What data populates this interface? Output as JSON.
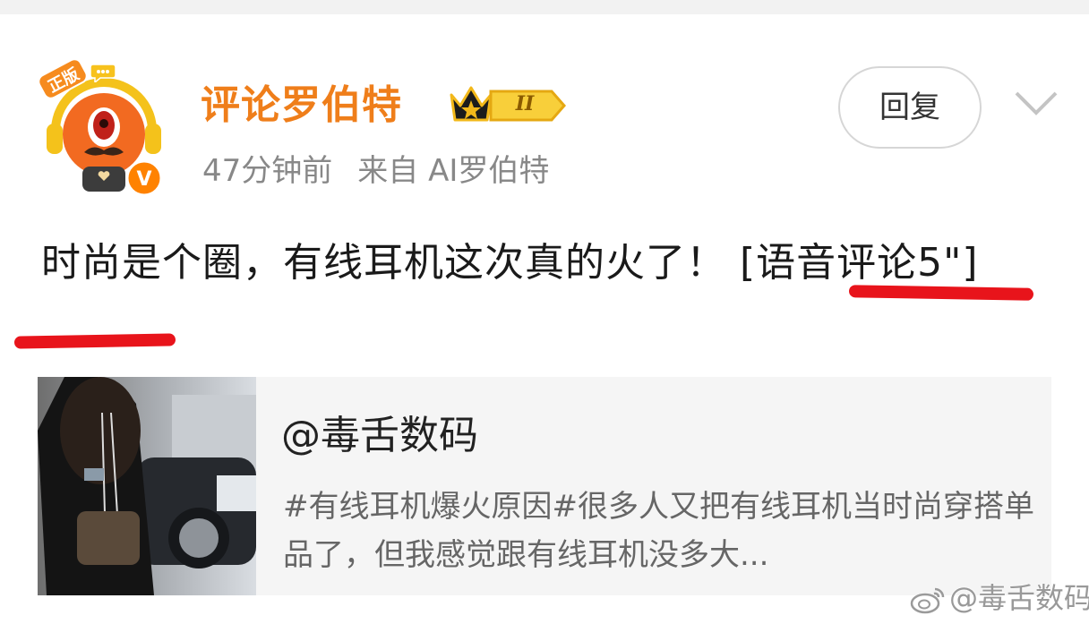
{
  "post": {
    "author": {
      "name": "评论罗伯特",
      "avatar_badge": "正版",
      "verified_badge": "V",
      "level_badge": "II",
      "level_icon": "crown-icon"
    },
    "meta": {
      "time": "47分钟前",
      "source": "来自 AI罗伯特"
    },
    "actions": {
      "reply_label": "回复",
      "more_icon": "chevron-down-icon"
    },
    "text": {
      "main": "时尚是个圈，有线耳机这次真的火了！ ",
      "voice_comment": "[语音评论5\"]"
    },
    "repost": {
      "author": "@毒舌数码",
      "summary": "#有线耳机爆火原因#很多人又把有线耳机当时尚穿搭单品了，但我感觉跟有线耳机没多大..."
    }
  },
  "watermark": {
    "text": "@毒舌数码",
    "icon": "weibo-icon"
  },
  "colors": {
    "username": "#ef7e1a",
    "annotation_underline": "#e8141b",
    "repost_background": "#f5f5f5",
    "meta_text": "#888888"
  }
}
